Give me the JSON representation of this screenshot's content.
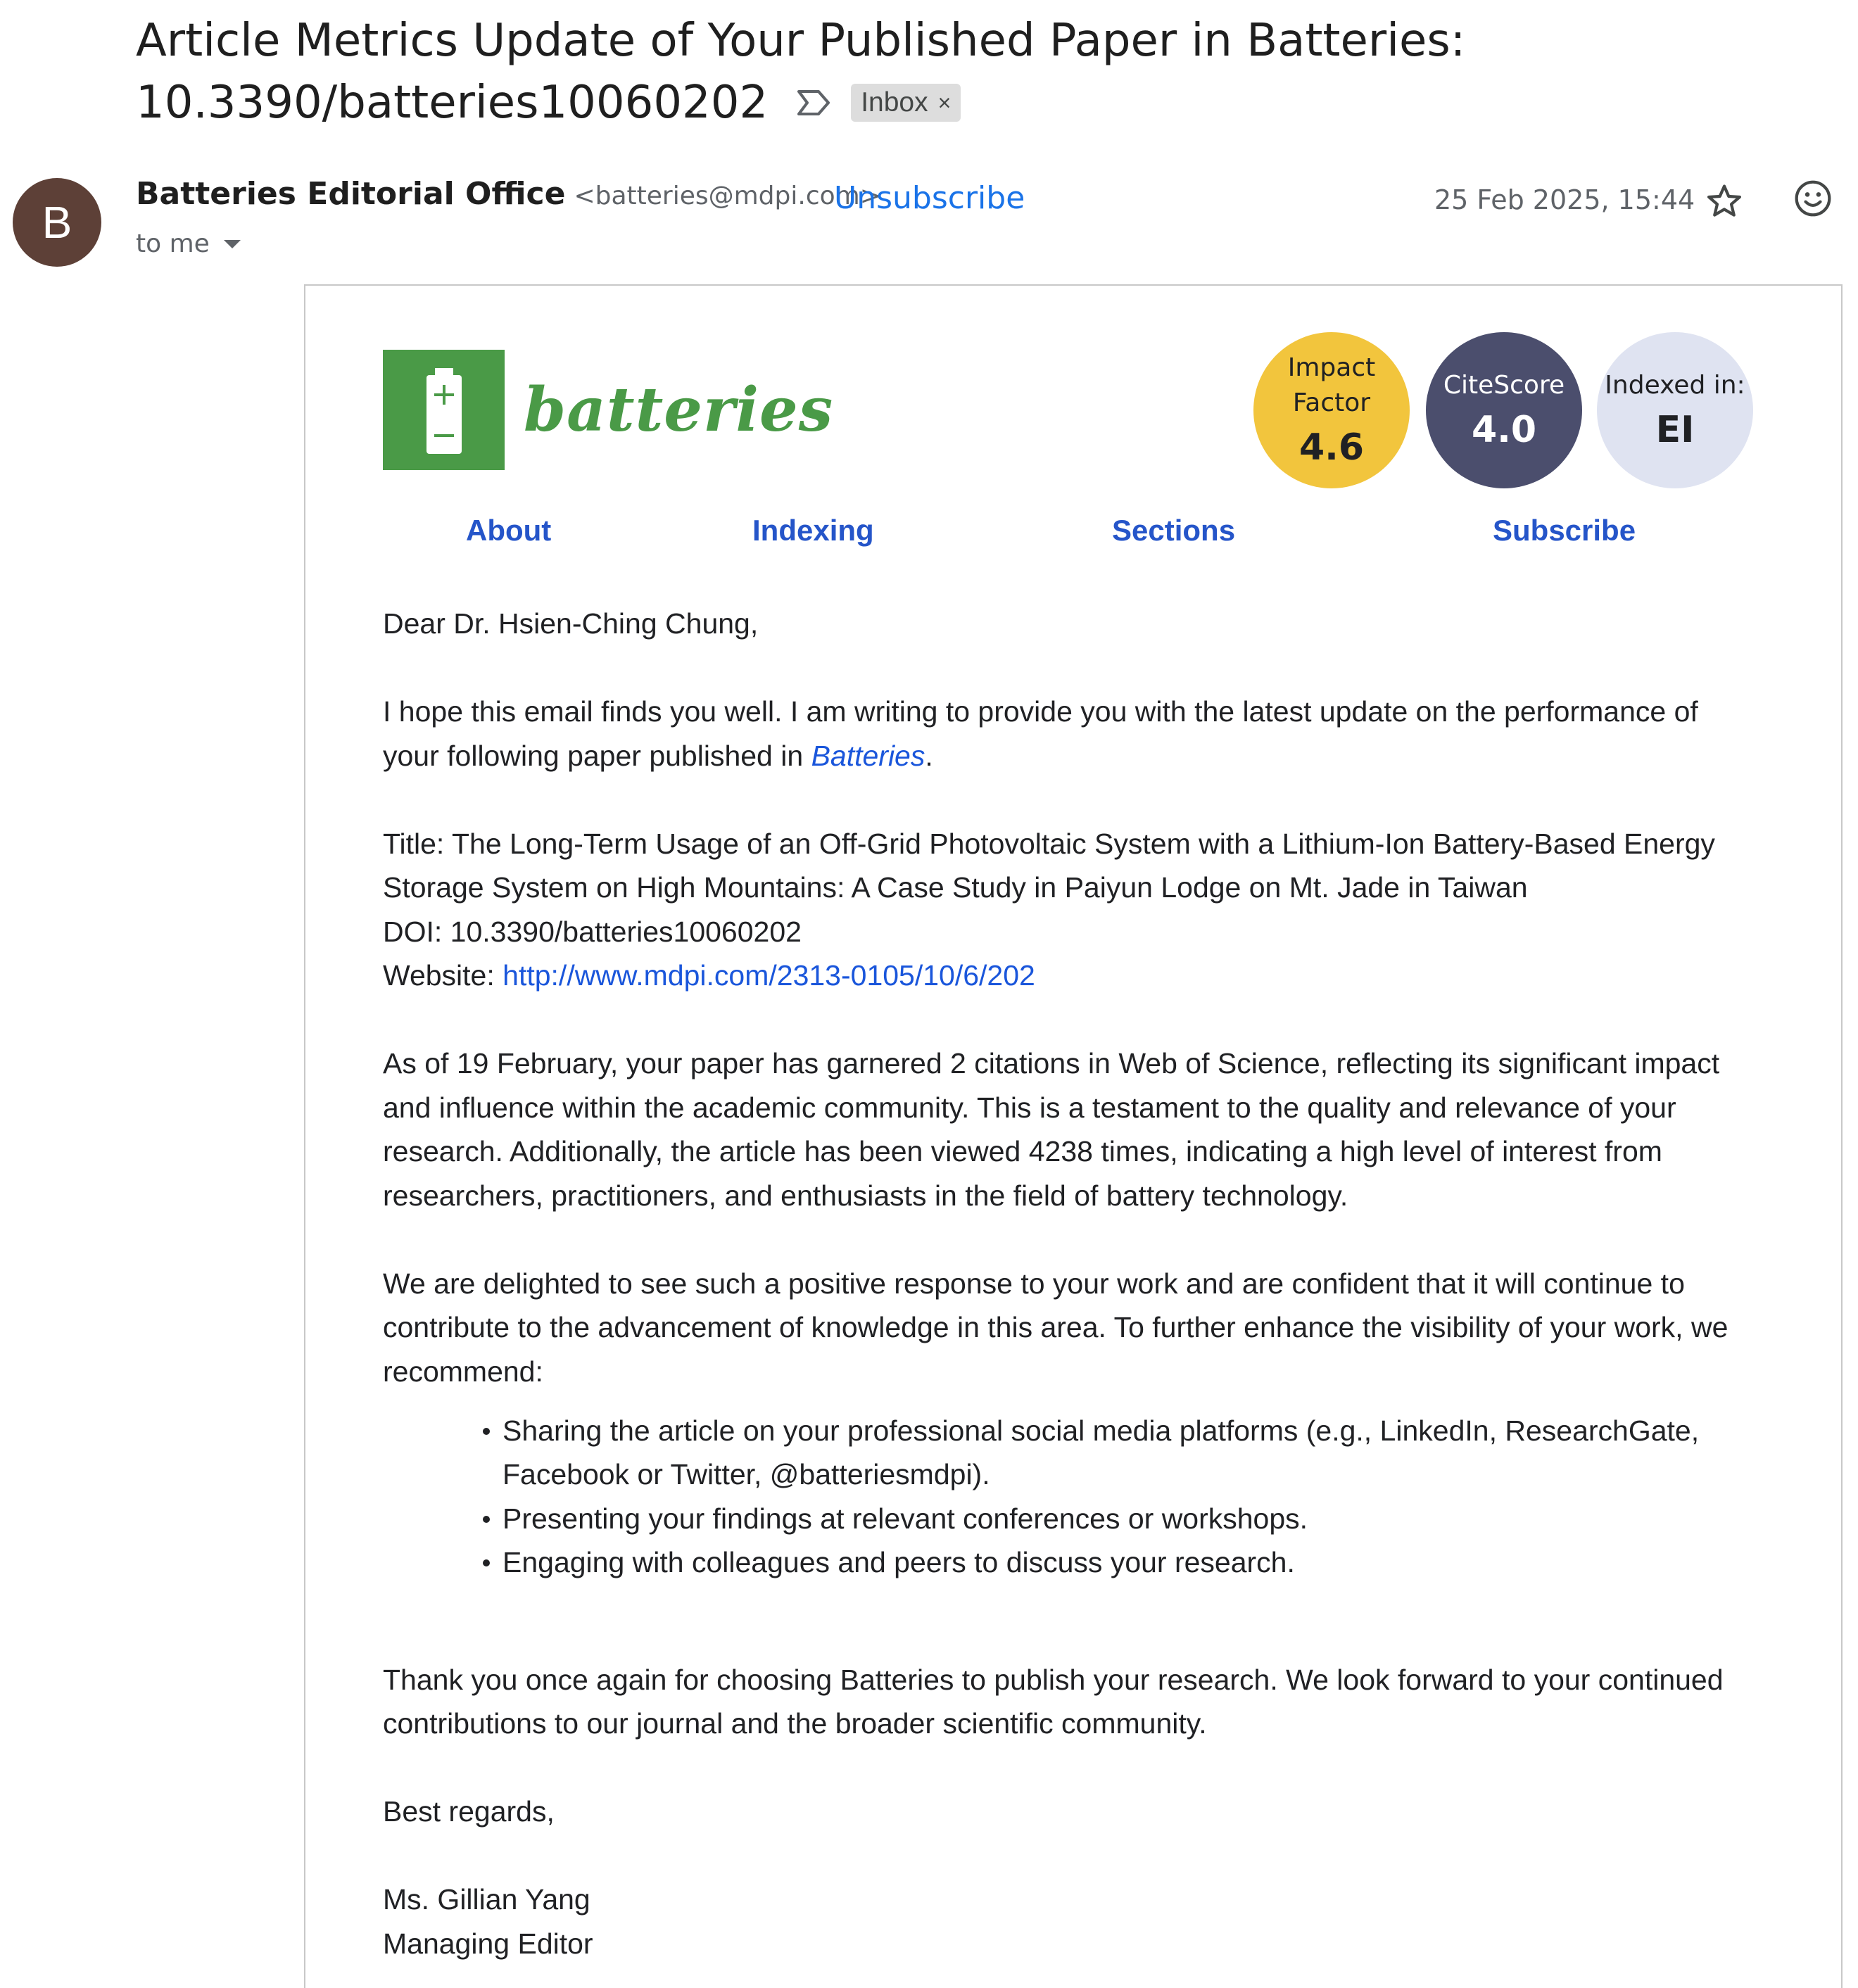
{
  "email": {
    "subject_line1": "Article Metrics Update of Your Published Paper in Batteries:",
    "subject_line2": "10.3390/batteries10060202",
    "label": "Inbox",
    "label_remove": "×",
    "sender_initial": "B",
    "sender_name": "Batteries Editorial Office",
    "sender_email": "<batteries@mdpi.com>",
    "unsubscribe": "Unsubscribe",
    "to": "to me",
    "date": "25 Feb 2025, 15:44",
    "icons": [
      "important-marker-icon",
      "label-close-icon",
      "chevron-down-icon",
      "star-icon",
      "emoji-reaction-icon"
    ]
  },
  "journal": {
    "logo_text": "batteries",
    "logo_color": "#4a9a47",
    "badges": [
      {
        "label_1": "Impact",
        "label_2": "Factor",
        "value": "4.6",
        "color": "#f2c53d"
      },
      {
        "label": "CiteScore",
        "value": "4.0",
        "color": "#4b4e6d"
      },
      {
        "label": "Indexed in:",
        "value": "EI",
        "color": "#dfe3f1"
      }
    ],
    "nav": [
      "About",
      "Indexing",
      "Sections",
      "Subscribe"
    ]
  },
  "body": {
    "greeting": "Dear Dr. Hsien-Ching Chung,",
    "intro": "I hope this email finds you well. I am writing to provide you with the latest update on the performance of your following paper published in ",
    "intro_journal": "Batteries",
    "intro_end": ".",
    "title_line": "Title: The Long-Term Usage of an Off-Grid Photovoltaic System with a Lithium-Ion Battery-Based Energy Storage System on High Mountains: A Case Study in Paiyun Lodge on Mt. Jade in Taiwan",
    "doi_line": "DOI: 10.3390/batteries10060202",
    "website_label": "Website: ",
    "website_url": "http://www.mdpi.com/2313-0105/10/6/202",
    "metrics": "As of 19 February, your paper has garnered 2 citations in Web of Science, reflecting its significant impact and influence within the academic community. This is a testament to the quality and relevance of your research. Additionally, the article has been viewed 4238 times, indicating a high level of interest from researchers, practitioners, and enthusiasts in the field of battery technology.",
    "recommend": "We are delighted to see such a positive response to your work and are confident that it will continue to contribute to the advancement of knowledge in this area. To further enhance the visibility of your work, we recommend:",
    "bullets": [
      "Sharing the article on your professional social media platforms (e.g., LinkedIn, ResearchGate, Facebook or Twitter, @batteriesmdpi).",
      "Presenting your findings at relevant conferences or workshops.",
      "Engaging with colleagues and peers to discuss your research."
    ],
    "thanks": "Thank you once again for choosing Batteries to publish your research. We look forward to your continued contributions to our journal and the broader scientific community.",
    "regards": "Best regards,",
    "signer_name": "Ms. Gillian Yang",
    "signer_title": "Managing Editor"
  }
}
